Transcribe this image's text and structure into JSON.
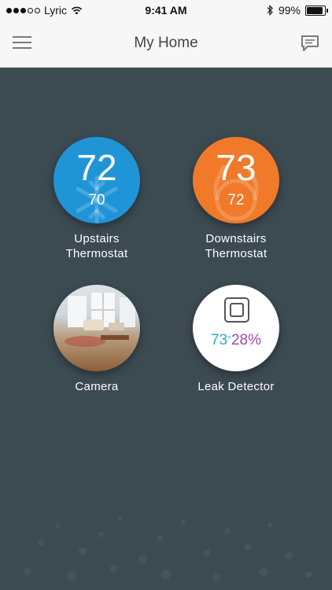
{
  "status_bar": {
    "carrier": "Lyric",
    "time": "9:41 AM",
    "battery": "99%"
  },
  "header": {
    "title": "My Home"
  },
  "icons": {
    "menu": "hamburger-icon",
    "messages": "message-icon",
    "wifi": "wifi-icon",
    "bluetooth": "bluetooth-icon",
    "battery": "battery-icon",
    "snowflake": "snowflake-icon",
    "flame": "flame-icon",
    "leak_sensor": "leak-sensor-icon"
  },
  "devices": [
    {
      "name_line1": "Upstairs",
      "name_line2": "Thermostat",
      "current": "72",
      "setpoint": "70",
      "mode": "cool",
      "color": "#1f95d8"
    },
    {
      "name_line1": "Downstairs",
      "name_line2": "Thermostat",
      "current": "73",
      "setpoint": "72",
      "mode": "heat",
      "color": "#f07a2a"
    },
    {
      "name": "Camera"
    },
    {
      "name": "Leak Detector",
      "temperature": "73",
      "degree": "°",
      "humidity": "28%"
    }
  ],
  "colors": {
    "background": "#3c4a52",
    "cool": "#1f95d8",
    "heat": "#f07a2a",
    "leak_temp": "#2ea6d6",
    "leak_humidity": "#a24aa6"
  }
}
